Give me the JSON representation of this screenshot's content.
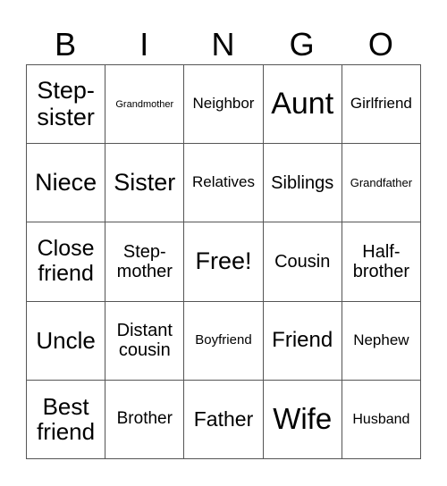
{
  "header": {
    "letters": [
      "B",
      "I",
      "N",
      "G",
      "O"
    ]
  },
  "grid": {
    "rows": [
      [
        "Step-\nsister",
        "Grandmother",
        "Neighbor",
        "Aunt",
        "Girlfriend"
      ],
      [
        "Niece",
        "Sister",
        "Relatives",
        "Siblings",
        "Grandfather"
      ],
      [
        "Close friend",
        "Step-\nmother",
        "Free!",
        "Cousin",
        "Half-\nbrother"
      ],
      [
        "Uncle",
        "Distant cousin",
        "Boyfriend",
        "Friend",
        "Nephew"
      ],
      [
        "Best friend",
        "Brother",
        "Father",
        "Wife",
        "Husband"
      ]
    ],
    "cells": {
      "r0c0a": "Step-",
      "r0c0b": "sister",
      "r0c1": "Grandmother",
      "r0c2": "Neighbor",
      "r0c3": "Aunt",
      "r0c4": "Girlfriend",
      "r1c0": "Niece",
      "r1c1": "Sister",
      "r1c2": "Relatives",
      "r1c3": "Siblings",
      "r1c4": "Grandfather",
      "r2c0a": "Close",
      "r2c0b": "friend",
      "r2c1a": "Step-",
      "r2c1b": "mother",
      "r2c2": "Free!",
      "r2c3": "Cousin",
      "r2c4a": "Half-",
      "r2c4b": "brother",
      "r3c0": "Uncle",
      "r3c1a": "Distant",
      "r3c1b": "cousin",
      "r3c2": "Boyfriend",
      "r3c3": "Friend",
      "r3c4": "Nephew",
      "r4c0a": "Best",
      "r4c0b": "friend",
      "r4c1": "Brother",
      "r4c2": "Father",
      "r4c3": "Wife",
      "r4c4": "Husband"
    }
  }
}
